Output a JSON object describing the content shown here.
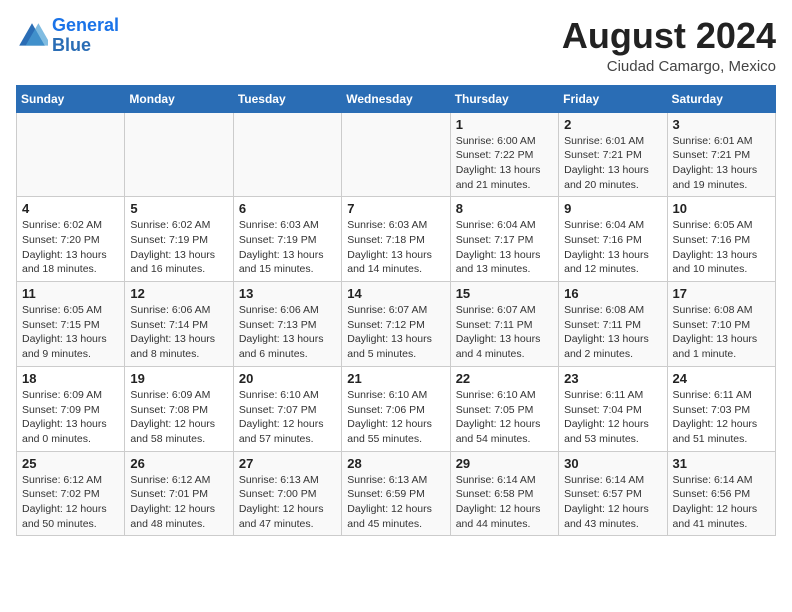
{
  "header": {
    "logo_line1": "General",
    "logo_line2": "Blue",
    "month_title": "August 2024",
    "subtitle": "Ciudad Camargo, Mexico"
  },
  "days_of_week": [
    "Sunday",
    "Monday",
    "Tuesday",
    "Wednesday",
    "Thursday",
    "Friday",
    "Saturday"
  ],
  "weeks": [
    [
      {
        "day": "",
        "info": ""
      },
      {
        "day": "",
        "info": ""
      },
      {
        "day": "",
        "info": ""
      },
      {
        "day": "",
        "info": ""
      },
      {
        "day": "1",
        "info": "Sunrise: 6:00 AM\nSunset: 7:22 PM\nDaylight: 13 hours and 21 minutes."
      },
      {
        "day": "2",
        "info": "Sunrise: 6:01 AM\nSunset: 7:21 PM\nDaylight: 13 hours and 20 minutes."
      },
      {
        "day": "3",
        "info": "Sunrise: 6:01 AM\nSunset: 7:21 PM\nDaylight: 13 hours and 19 minutes."
      }
    ],
    [
      {
        "day": "4",
        "info": "Sunrise: 6:02 AM\nSunset: 7:20 PM\nDaylight: 13 hours and 18 minutes."
      },
      {
        "day": "5",
        "info": "Sunrise: 6:02 AM\nSunset: 7:19 PM\nDaylight: 13 hours and 16 minutes."
      },
      {
        "day": "6",
        "info": "Sunrise: 6:03 AM\nSunset: 7:19 PM\nDaylight: 13 hours and 15 minutes."
      },
      {
        "day": "7",
        "info": "Sunrise: 6:03 AM\nSunset: 7:18 PM\nDaylight: 13 hours and 14 minutes."
      },
      {
        "day": "8",
        "info": "Sunrise: 6:04 AM\nSunset: 7:17 PM\nDaylight: 13 hours and 13 minutes."
      },
      {
        "day": "9",
        "info": "Sunrise: 6:04 AM\nSunset: 7:16 PM\nDaylight: 13 hours and 12 minutes."
      },
      {
        "day": "10",
        "info": "Sunrise: 6:05 AM\nSunset: 7:16 PM\nDaylight: 13 hours and 10 minutes."
      }
    ],
    [
      {
        "day": "11",
        "info": "Sunrise: 6:05 AM\nSunset: 7:15 PM\nDaylight: 13 hours and 9 minutes."
      },
      {
        "day": "12",
        "info": "Sunrise: 6:06 AM\nSunset: 7:14 PM\nDaylight: 13 hours and 8 minutes."
      },
      {
        "day": "13",
        "info": "Sunrise: 6:06 AM\nSunset: 7:13 PM\nDaylight: 13 hours and 6 minutes."
      },
      {
        "day": "14",
        "info": "Sunrise: 6:07 AM\nSunset: 7:12 PM\nDaylight: 13 hours and 5 minutes."
      },
      {
        "day": "15",
        "info": "Sunrise: 6:07 AM\nSunset: 7:11 PM\nDaylight: 13 hours and 4 minutes."
      },
      {
        "day": "16",
        "info": "Sunrise: 6:08 AM\nSunset: 7:11 PM\nDaylight: 13 hours and 2 minutes."
      },
      {
        "day": "17",
        "info": "Sunrise: 6:08 AM\nSunset: 7:10 PM\nDaylight: 13 hours and 1 minute."
      }
    ],
    [
      {
        "day": "18",
        "info": "Sunrise: 6:09 AM\nSunset: 7:09 PM\nDaylight: 13 hours and 0 minutes."
      },
      {
        "day": "19",
        "info": "Sunrise: 6:09 AM\nSunset: 7:08 PM\nDaylight: 12 hours and 58 minutes."
      },
      {
        "day": "20",
        "info": "Sunrise: 6:10 AM\nSunset: 7:07 PM\nDaylight: 12 hours and 57 minutes."
      },
      {
        "day": "21",
        "info": "Sunrise: 6:10 AM\nSunset: 7:06 PM\nDaylight: 12 hours and 55 minutes."
      },
      {
        "day": "22",
        "info": "Sunrise: 6:10 AM\nSunset: 7:05 PM\nDaylight: 12 hours and 54 minutes."
      },
      {
        "day": "23",
        "info": "Sunrise: 6:11 AM\nSunset: 7:04 PM\nDaylight: 12 hours and 53 minutes."
      },
      {
        "day": "24",
        "info": "Sunrise: 6:11 AM\nSunset: 7:03 PM\nDaylight: 12 hours and 51 minutes."
      }
    ],
    [
      {
        "day": "25",
        "info": "Sunrise: 6:12 AM\nSunset: 7:02 PM\nDaylight: 12 hours and 50 minutes."
      },
      {
        "day": "26",
        "info": "Sunrise: 6:12 AM\nSunset: 7:01 PM\nDaylight: 12 hours and 48 minutes."
      },
      {
        "day": "27",
        "info": "Sunrise: 6:13 AM\nSunset: 7:00 PM\nDaylight: 12 hours and 47 minutes."
      },
      {
        "day": "28",
        "info": "Sunrise: 6:13 AM\nSunset: 6:59 PM\nDaylight: 12 hours and 45 minutes."
      },
      {
        "day": "29",
        "info": "Sunrise: 6:14 AM\nSunset: 6:58 PM\nDaylight: 12 hours and 44 minutes."
      },
      {
        "day": "30",
        "info": "Sunrise: 6:14 AM\nSunset: 6:57 PM\nDaylight: 12 hours and 43 minutes."
      },
      {
        "day": "31",
        "info": "Sunrise: 6:14 AM\nSunset: 6:56 PM\nDaylight: 12 hours and 41 minutes."
      }
    ]
  ]
}
